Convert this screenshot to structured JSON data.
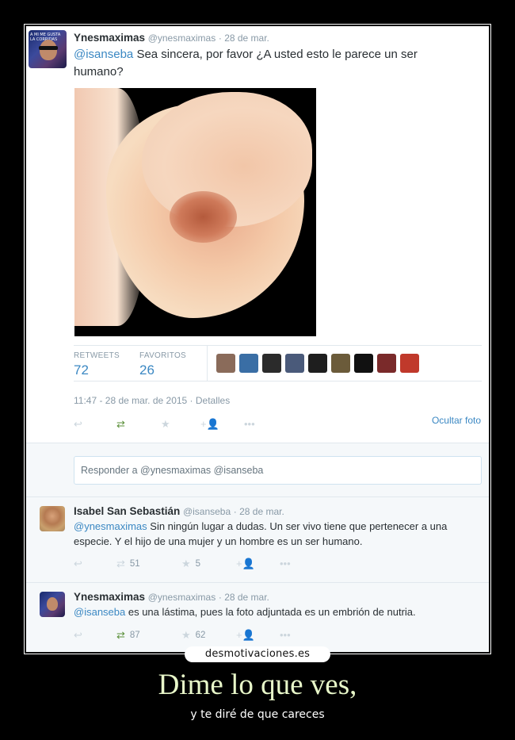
{
  "main_tweet": {
    "name": "Ynesmaximas",
    "handle": "@ynesmaximas",
    "date": "· 28 de mar.",
    "mention": "@isanseba",
    "text": " Sea sincera, por favor ¿A usted esto le parece un ser humano?",
    "avatar_text": "A MI ME GUSTA LA CORRIDAS",
    "retweets_label": "RETWEETS",
    "retweets_value": "72",
    "favorites_label": "FAVORITOS",
    "favorites_value": "26",
    "timestamp": "11:47 - 28 de mar. de 2015 · Detalles",
    "hide_photo": "Ocultar foto",
    "favoriter_faces": [
      "#8a6b5a",
      "#3a6ea5",
      "#2b2b2b",
      "#4a5a7a",
      "#1e1e1e",
      "#6b5b3a",
      "#111111",
      "#7a2a2a",
      "#c0392b"
    ]
  },
  "reply_box": {
    "text": "Responder a @ynesmaximas @isanseba"
  },
  "replies": [
    {
      "name": "Isabel San Sebastián",
      "handle": "@isanseba",
      "date": "· 28 de mar.",
      "mention": "@ynesmaximas",
      "text": " Sin ningún lugar a dudas. Un ser vivo tiene que pertenecer a una especie. Y el hijo de una mujer y un hombre es un ser humano.",
      "retweets": "51",
      "favorites": "5"
    },
    {
      "name": "Ynesmaximas",
      "handle": "@ynesmaximas",
      "date": "· 28 de mar.",
      "mention": "@isanseba",
      "text": " es una lástima, pues la foto adjuntada es un embrión de nutria.",
      "retweets": "87",
      "favorites": "62"
    }
  ],
  "watermark": "desmotivaciones.es",
  "caption": {
    "title": "Dime lo que ves,",
    "subtitle": "y te diré de que careces"
  },
  "icons": {
    "reply": "↩",
    "retweet": "⇄",
    "favorite": "★",
    "follow": "+👤",
    "more": "•••"
  }
}
